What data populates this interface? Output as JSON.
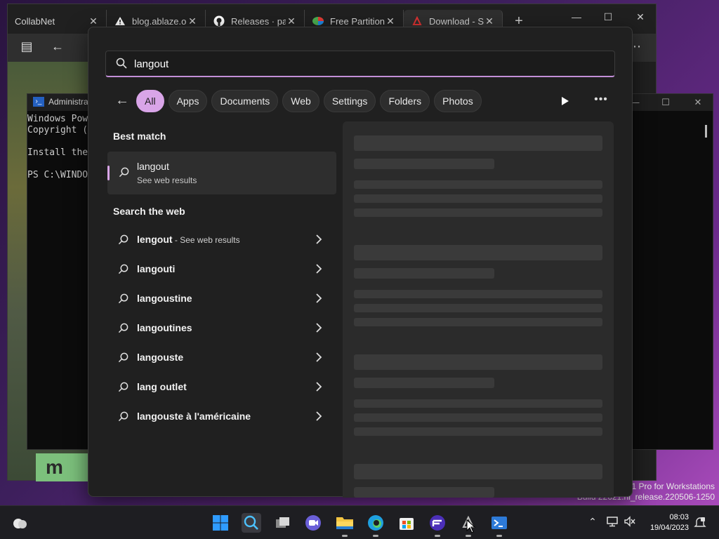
{
  "browser": {
    "tabs": [
      {
        "label": "CollabNet",
        "icon": "none"
      },
      {
        "label": "blog.ablaze.or",
        "icon": "warning-icon"
      },
      {
        "label": "Releases · pal",
        "icon": "github-icon"
      },
      {
        "label": "Free Partition",
        "icon": "partition-app-icon"
      },
      {
        "label": "Download - Su",
        "icon": "download-site-icon"
      }
    ],
    "apple_banner_text": "m"
  },
  "powershell": {
    "title": "Administra",
    "lines": [
      "Windows Pow",
      "Copyright (",
      "",
      "Install the",
      "",
      "PS C:\\WINDO"
    ]
  },
  "watermark": {
    "line1": "1 Pro for Workstations",
    "line2": "Build 22621.ni_release.220506-1250"
  },
  "search": {
    "query": "langout",
    "filters": [
      "All",
      "Apps",
      "Documents",
      "Web",
      "Settings",
      "Folders",
      "Photos"
    ],
    "active_filter": "All",
    "best_match_heading": "Best match",
    "best_match": {
      "title": "langout",
      "subtitle": "See web results"
    },
    "web_heading": "Search the web",
    "web_results": [
      {
        "text": "lengout",
        "suffix": " - See web results"
      },
      {
        "text": "langouti",
        "suffix": ""
      },
      {
        "text": "langoustine",
        "suffix": ""
      },
      {
        "text": "langoutines",
        "suffix": ""
      },
      {
        "text": "langouste",
        "suffix": ""
      },
      {
        "text": "lang outlet",
        "suffix": ""
      },
      {
        "text": "langouste à l'américaine",
        "suffix": ""
      }
    ]
  },
  "taskbar": {
    "apps": [
      "start-icon",
      "search-icon",
      "task-view-icon",
      "teams-icon",
      "file-explorer-icon",
      "edge-icon",
      "store-icon",
      "floorp-icon",
      "app-icon",
      "terminal-icon"
    ],
    "time": "08:03",
    "date": "19/04/2023"
  },
  "colors": {
    "accent": "#d9a5e8",
    "panel_bg": "#202020",
    "preview_bg": "#2b2b2b"
  }
}
